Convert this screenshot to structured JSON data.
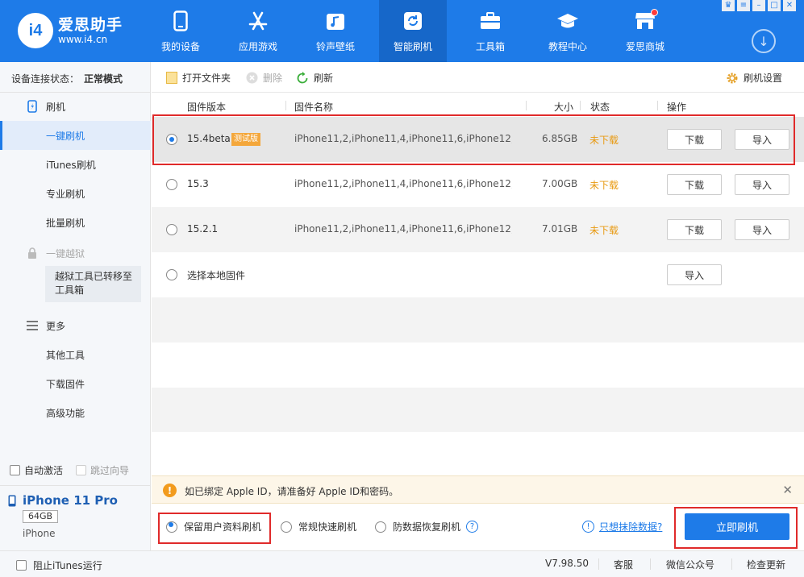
{
  "app": {
    "name": "爱思助手",
    "url": "www.i4.cn",
    "logo_text": "i4"
  },
  "nav": [
    {
      "label": "我的设备",
      "icon": "phone-icon"
    },
    {
      "label": "应用游戏",
      "icon": "app-store-icon"
    },
    {
      "label": "铃声壁纸",
      "icon": "music-icon"
    },
    {
      "label": "智能刷机",
      "icon": "refresh-icon"
    },
    {
      "label": "工具箱",
      "icon": "toolbox-icon"
    },
    {
      "label": "教程中心",
      "icon": "graduation-cap-icon"
    },
    {
      "label": "爱思商城",
      "icon": "shop-icon"
    }
  ],
  "sidebar": {
    "status_label": "设备连接状态：",
    "status_value": "正常模式",
    "flash_header": "刷机",
    "items": [
      "一键刷机",
      "iTunes刷机",
      "专业刷机",
      "批量刷机"
    ],
    "jailbreak_header": "一键越狱",
    "jailbreak_note_line1": "越狱工具已转移至",
    "jailbreak_note_line2": "工具箱",
    "more_header": "更多",
    "more_items": [
      "其他工具",
      "下载固件",
      "高级功能"
    ],
    "auto_activate": "自动激活",
    "skip_guide": "跳过向导"
  },
  "device": {
    "name": "iPhone 11 Pro",
    "capacity": "64GB",
    "model": "iPhone"
  },
  "toolbar": {
    "open_folder": "打开文件夹",
    "delete": "删除",
    "refresh": "刷新",
    "settings": "刷机设置"
  },
  "table": {
    "headers": {
      "version": "固件版本",
      "name": "固件名称",
      "size": "大小",
      "status": "状态",
      "action": "操作"
    },
    "rows": [
      {
        "version": "15.4beta",
        "badge": "测试版",
        "name": "iPhone11,2,iPhone11,4,iPhone11,6,iPhone12,...",
        "size": "6.85GB",
        "status": "未下载",
        "download": "下载",
        "import": "导入"
      },
      {
        "version": "15.3",
        "name": "iPhone11,2,iPhone11,4,iPhone11,6,iPhone12,...",
        "size": "7.00GB",
        "status": "未下载",
        "download": "下载",
        "import": "导入"
      },
      {
        "version": "15.2.1",
        "name": "iPhone11,2,iPhone11,4,iPhone11,6,iPhone12,...",
        "size": "7.01GB",
        "status": "未下载",
        "download": "下载",
        "import": "导入"
      }
    ],
    "local_label": "选择本地固件",
    "local_import": "导入"
  },
  "notice": {
    "text": "如已绑定 Apple ID，请准备好 Apple ID和密码。"
  },
  "options": {
    "keep_data": "保留用户资料刷机",
    "quick": "常规快速刷机",
    "anti_recovery": "防数据恢复刷机",
    "help": "?",
    "erase_link": "只想抹除数据?",
    "erase_icon": "!",
    "flash_now": "立即刷机"
  },
  "footer": {
    "block_itunes": "阻止iTunes运行",
    "version": "V7.98.50",
    "service": "客服",
    "wechat": "微信公众号",
    "update": "检查更新"
  },
  "colors": {
    "accent": "#1e7be8",
    "warn": "#e89a12",
    "highlight": "#e02a2a"
  }
}
